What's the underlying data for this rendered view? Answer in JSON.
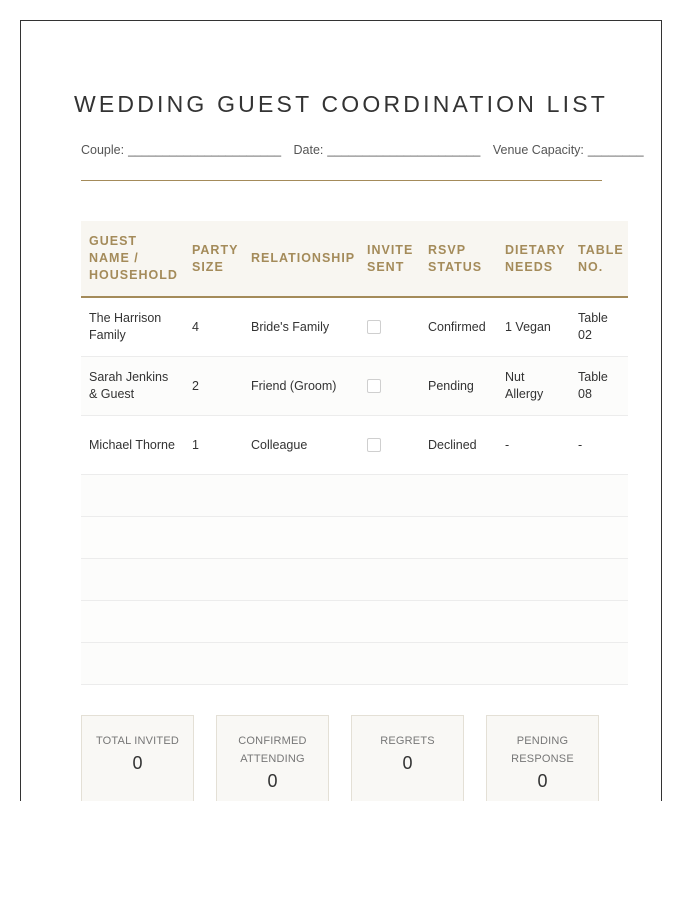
{
  "title": "WEDDING GUEST COORDINATION LIST",
  "meta": {
    "couple_label": "Couple:",
    "couple_blank": "______________________",
    "date_label": "Date:",
    "date_blank": "______________________",
    "capacity_label": "Venue Capacity:",
    "capacity_blank": "________"
  },
  "table": {
    "headers": [
      "GUEST NAME / HOUSEHOLD",
      "PARTY SIZE",
      "RELATIONSHIP",
      "INVITE SENT",
      "RSVP STATUS",
      "DIETARY NEEDS",
      "TABLE NO."
    ],
    "rows": [
      {
        "name": "The Harrison Family",
        "party": "4",
        "relationship": "Bride's Family",
        "invite_sent": false,
        "rsvp": "Confirmed",
        "dietary": "1 Vegan",
        "table": "Table 02"
      },
      {
        "name": "Sarah Jenkins & Guest",
        "party": "2",
        "relationship": "Friend (Groom)",
        "invite_sent": false,
        "rsvp": "Pending",
        "dietary": "Nut Allergy",
        "table": "Table 08"
      },
      {
        "name": "Michael Thorne",
        "party": "1",
        "relationship": "Colleague",
        "invite_sent": false,
        "rsvp": "Declined",
        "dietary": "-",
        "table": "-"
      }
    ]
  },
  "summary": [
    {
      "label": "TOTAL INVITED",
      "value": "0"
    },
    {
      "label": "CONFIRMED ATTENDING",
      "value": "0"
    },
    {
      "label": "REGRETS",
      "value": "0"
    },
    {
      "label": "PENDING RESPONSE",
      "value": "0"
    }
  ],
  "colors": {
    "accent": "#a48b5a",
    "header_bg": "#f8f6f1",
    "text": "#333333"
  }
}
